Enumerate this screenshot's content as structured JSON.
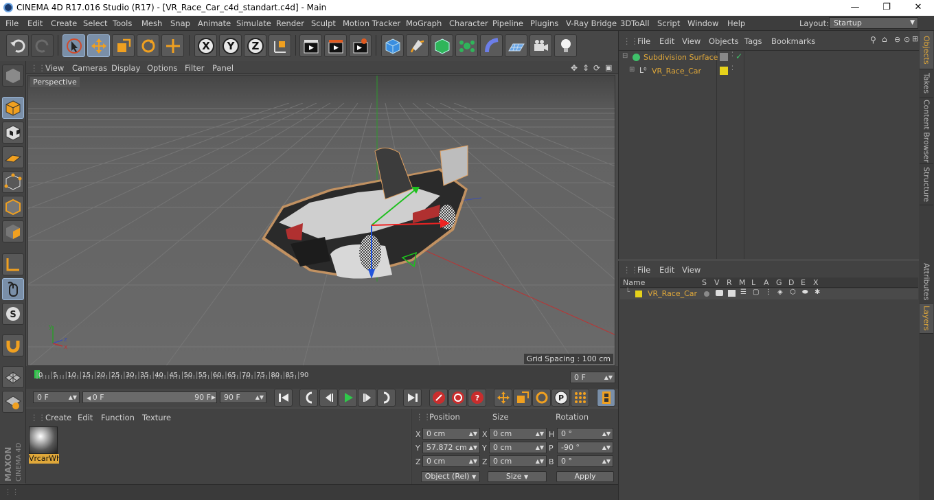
{
  "window": {
    "title": "CINEMA 4D R17.016 Studio (R17) - [VR_Race_Car_c4d_standart.c4d] - Main",
    "minimize": "—",
    "maximize": "❐",
    "close": "✕"
  },
  "menubar": {
    "items": [
      "File",
      "Edit",
      "Create",
      "Select",
      "Tools",
      "Mesh",
      "Snap",
      "Animate",
      "Simulate",
      "Render",
      "Sculpt",
      "Motion Tracker",
      "MoGraph",
      "Character",
      "Pipeline",
      "Plugins",
      "V-Ray Bridge",
      "3DToAll",
      "Script",
      "Window",
      "Help"
    ],
    "layout_label": "Layout:",
    "layout_value": "Startup"
  },
  "viewport": {
    "menu": [
      "View",
      "Cameras",
      "Display",
      "Options",
      "Filter",
      "Panel"
    ],
    "camera_label": "Perspective",
    "grid_spacing": "Grid Spacing : 100 cm",
    "axis_labels": {
      "y": "y",
      "z": "z",
      "x": "x"
    }
  },
  "timeline": {
    "ticks": [
      "0",
      "5",
      "10",
      "15",
      "20",
      "25",
      "30",
      "35",
      "40",
      "45",
      "50",
      "55",
      "60",
      "65",
      "70",
      "75",
      "80",
      "85",
      "90"
    ],
    "current_frame": "0 F"
  },
  "transport": {
    "start_field": "0 F",
    "range_start": "0 F",
    "range_end": "90 F",
    "end_field": "90 F"
  },
  "material_manager": {
    "menu": [
      "Create",
      "Edit",
      "Function",
      "Texture"
    ],
    "material_name": "VrcarWh"
  },
  "coordinates": {
    "headers": {
      "position": "Position",
      "size": "Size",
      "rotation": "Rotation"
    },
    "rows": [
      {
        "axis": "X",
        "pos": "0 cm",
        "size_axis": "X",
        "size": "0 cm",
        "rot_axis": "H",
        "rot": "0 °"
      },
      {
        "axis": "Y",
        "pos": "57.872 cm",
        "size_axis": "Y",
        "size": "0 cm",
        "rot_axis": "P",
        "rot": "-90 °"
      },
      {
        "axis": "Z",
        "pos": "0 cm",
        "size_axis": "Z",
        "size": "0 cm",
        "rot_axis": "B",
        "rot": "0 °"
      }
    ],
    "mode_select": "Object (Rel)",
    "size_select": "Size",
    "apply": "Apply"
  },
  "object_manager": {
    "menu": [
      "File",
      "Edit",
      "View",
      "Objects",
      "Tags",
      "Bookmarks"
    ],
    "objects": [
      {
        "name": "Subdivision Surface"
      },
      {
        "name": "VR_Race_Car"
      }
    ]
  },
  "layer_manager": {
    "menu": [
      "File",
      "Edit",
      "View"
    ],
    "columns": [
      "Name",
      "S",
      "V",
      "R",
      "M",
      "L",
      "A",
      "G",
      "D",
      "E",
      "X"
    ],
    "layers": [
      {
        "name": "VR_Race_Car",
        "color": "#e6d21a"
      }
    ]
  },
  "side_tabs": [
    "Objects",
    "Takes",
    "Content Browser",
    "Structure",
    "Attributes",
    "Layers"
  ],
  "logo": {
    "brand": "MAXON",
    "product": "CINEMA 4D"
  },
  "colors": {
    "accent": "#e0a83a",
    "selection": "#7a8fa8",
    "layer_yellow": "#e6d21a"
  }
}
